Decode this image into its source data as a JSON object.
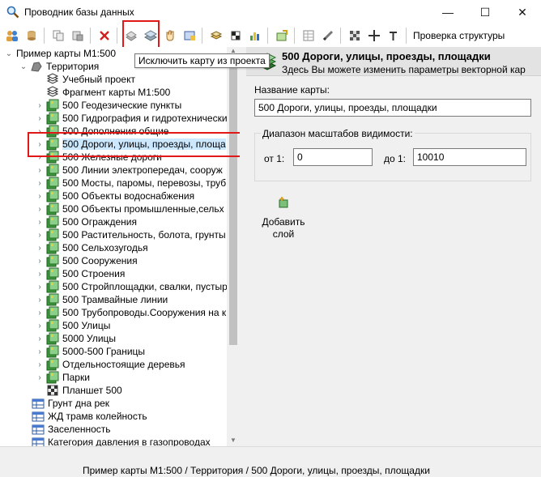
{
  "window": {
    "title": "Проводник базы данных",
    "minimize": "—",
    "maximize": "☐",
    "close": "✕"
  },
  "toolbar": {
    "buttons": [
      "users-icon",
      "database-icon",
      "copy-icon",
      "paste-icon",
      "delete-icon",
      "add-map-icon",
      "exclude-map-icon",
      "hand-icon",
      "map-settings-icon",
      "layers-icon",
      "grid-icon",
      "chart-icon",
      "export-icon",
      "table-icon",
      "edit-icon",
      "checkerboard-icon",
      "move-icon",
      "text-icon"
    ],
    "check_structure": "Проверка структуры",
    "tooltip": "Исключить карту из проекта"
  },
  "tree": {
    "root": "Пример карты М1:500",
    "territory": "Территория",
    "items": [
      {
        "label": "Учебный проект",
        "icon": "stack-icon",
        "expandable": false
      },
      {
        "label": "Фрагмент карты М1:500",
        "icon": "stack-icon",
        "expandable": false
      },
      {
        "label": "500 Геодезические пункты",
        "icon": "layer-icon",
        "expandable": true
      },
      {
        "label": "500 Гидрография и гидротехнически",
        "icon": "layer-icon",
        "expandable": true
      },
      {
        "label": "500 Дополнения общие",
        "icon": "layer-icon",
        "expandable": true
      },
      {
        "label": "500 Дороги, улицы, проезды, площа",
        "icon": "layer-icon",
        "expandable": true
      },
      {
        "label": "500 Железные дороги",
        "icon": "layer-icon",
        "expandable": true
      },
      {
        "label": "500 Линии электропередач, сооруж",
        "icon": "layer-icon",
        "expandable": true
      },
      {
        "label": "500 Мосты, паромы, перевозы, труб",
        "icon": "layer-icon",
        "expandable": true
      },
      {
        "label": "500 Объекты водоснабжения",
        "icon": "layer-icon",
        "expandable": true
      },
      {
        "label": "500 Объекты промышленные,сельх",
        "icon": "layer-icon",
        "expandable": true
      },
      {
        "label": "500 Ограждения",
        "icon": "layer-icon",
        "expandable": true
      },
      {
        "label": "500 Растительность, болота, грунты",
        "icon": "layer-icon",
        "expandable": true
      },
      {
        "label": "500 Сельхозугодья",
        "icon": "layer-icon",
        "expandable": true
      },
      {
        "label": "500 Сооружения",
        "icon": "layer-icon",
        "expandable": true
      },
      {
        "label": "500 Строения",
        "icon": "layer-icon",
        "expandable": true
      },
      {
        "label": "500 Стройплощадки, свалки, пустыр",
        "icon": "layer-icon",
        "expandable": true
      },
      {
        "label": "500 Трамвайные линии",
        "icon": "layer-icon",
        "expandable": true
      },
      {
        "label": "500 Трубопроводы.Сооружения на к",
        "icon": "layer-icon",
        "expandable": true
      },
      {
        "label": "500 Улицы",
        "icon": "layer-icon",
        "expandable": true
      },
      {
        "label": "5000 Улицы",
        "icon": "layer-icon",
        "expandable": true
      },
      {
        "label": "5000-500 Границы",
        "icon": "layer-icon",
        "expandable": true
      },
      {
        "label": "Отдельностоящие деревья",
        "icon": "layer-icon",
        "expandable": true
      },
      {
        "label": "Парки",
        "icon": "layer-icon",
        "expandable": true
      },
      {
        "label": "Планшет 500",
        "icon": "checker-icon",
        "expandable": false
      }
    ],
    "root_items": [
      {
        "label": "Грунт дна рек",
        "icon": "table-icon"
      },
      {
        "label": "ЖД трамв колейность",
        "icon": "table-icon"
      },
      {
        "label": "Заселенность",
        "icon": "table-icon"
      },
      {
        "label": "Категория давления в газопроводах",
        "icon": "table-icon"
      }
    ],
    "selected_index": 5
  },
  "details": {
    "title": "500 Дороги, улицы, проезды, площадки",
    "subtitle": "Здесь Вы можете изменить параметры векторной кар",
    "map_name_label": "Название карты:",
    "map_name_value": "500 Дороги, улицы, проезды, площадки",
    "scale_group_title": "Диапазон масштабов видимости:",
    "from_label": "от 1:",
    "from_value": "0",
    "to_label": "до 1:",
    "to_value": "10010",
    "add_layer_line1": "Добавить",
    "add_layer_line2": "слой"
  },
  "status": {
    "path": "Пример карты М1:500 / Территория / 500 Дороги, улицы, проезды, площадки"
  },
  "colors": {
    "highlight": "#e01818",
    "selected": "#cce8ff",
    "pane_bg": "#f0f0f0"
  }
}
